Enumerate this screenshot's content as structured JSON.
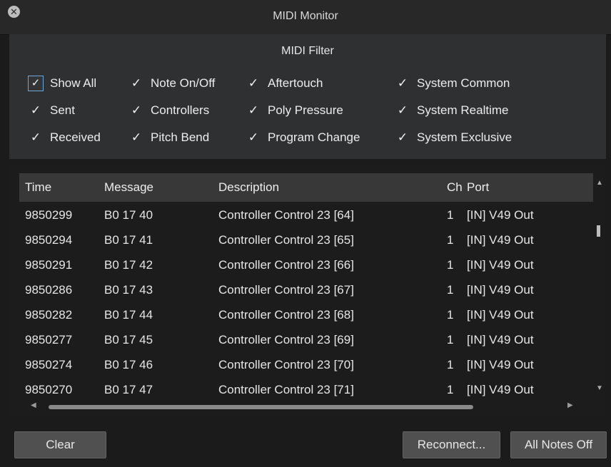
{
  "window": {
    "title": "MIDI Monitor"
  },
  "filter": {
    "title": "MIDI Filter",
    "checkboxes": [
      {
        "label": "Show All",
        "checked": true
      },
      {
        "label": "Sent",
        "checked": true
      },
      {
        "label": "Received",
        "checked": true
      },
      {
        "label": "Note On/Off",
        "checked": true
      },
      {
        "label": "Controllers",
        "checked": true
      },
      {
        "label": "Pitch Bend",
        "checked": true
      },
      {
        "label": "Aftertouch",
        "checked": true
      },
      {
        "label": "Poly Pressure",
        "checked": true
      },
      {
        "label": "Program Change",
        "checked": true
      },
      {
        "label": "System Common",
        "checked": true
      },
      {
        "label": "System Realtime",
        "checked": true
      },
      {
        "label": "System Exclusive",
        "checked": true
      }
    ],
    "check_glyph": "✓"
  },
  "table": {
    "columns": [
      "Time",
      "Message",
      "Description",
      "Ch",
      "Port"
    ],
    "rows": [
      [
        "9850299",
        "B0 17 40",
        "Controller Control 23 [64]",
        "1",
        "[IN] V49 Out"
      ],
      [
        "9850294",
        "B0 17 41",
        "Controller Control 23 [65]",
        "1",
        "[IN] V49 Out"
      ],
      [
        "9850291",
        "B0 17 42",
        "Controller Control 23 [66]",
        "1",
        "[IN] V49 Out"
      ],
      [
        "9850286",
        "B0 17 43",
        "Controller Control 23 [67]",
        "1",
        "[IN] V49 Out"
      ],
      [
        "9850282",
        "B0 17 44",
        "Controller Control 23 [68]",
        "1",
        "[IN] V49 Out"
      ],
      [
        "9850277",
        "B0 17 45",
        "Controller Control 23 [69]",
        "1",
        "[IN] V49 Out"
      ],
      [
        "9850274",
        "B0 17 46",
        "Controller Control 23 [70]",
        "1",
        "[IN] V49 Out"
      ],
      [
        "9850270",
        "B0 17 47",
        "Controller Control 23 [71]",
        "1",
        "[IN] V49 Out"
      ]
    ]
  },
  "buttons": {
    "clear": "Clear",
    "reconnect": "Reconnect...",
    "all_notes_off": "All Notes Off"
  },
  "icons": {
    "close": "close-icon",
    "scroll_up": "scroll-up-arrow-icon",
    "scroll_down": "scroll-down-arrow-icon",
    "scroll_left": "scroll-left-arrow-icon",
    "scroll_right": "scroll-right-arrow-icon"
  },
  "colors": {
    "background": "#1b1b1c",
    "panel": "#2f3032",
    "header": "#383838",
    "focus_ring": "#6ea8d8",
    "button": "#505050"
  }
}
